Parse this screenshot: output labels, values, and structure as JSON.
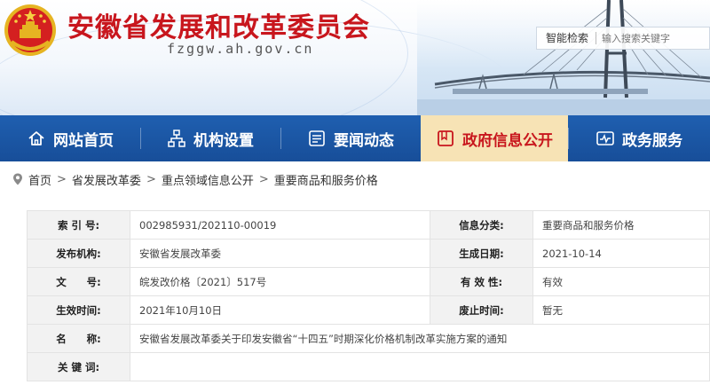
{
  "header": {
    "title": "安徽省发展和改革委员会",
    "domain": "fzggw.ah.gov.cn",
    "search_label": "智能检索",
    "search_placeholder": "输入搜索关键字"
  },
  "nav": {
    "items": [
      {
        "label": "网站首页",
        "icon": "home-icon"
      },
      {
        "label": "机构设置",
        "icon": "org-chart-icon"
      },
      {
        "label": "要闻动态",
        "icon": "news-icon"
      },
      {
        "label": "政府信息公开",
        "icon": "folder-icon",
        "active": true
      },
      {
        "label": "政务服务",
        "icon": "service-icon"
      }
    ]
  },
  "breadcrumb": [
    "首页",
    "省发展改革委",
    "重点领域信息公开",
    "重要商品和服务价格"
  ],
  "info": {
    "index_label": "索 引 号:",
    "index_value": "002985931/202110-00019",
    "category_label": "信息分类:",
    "category_value": "重要商品和服务价格",
    "publisher_label": "发布机构:",
    "publisher_value": "安徽省发展改革委",
    "created_label": "生成日期:",
    "created_value": "2021-10-14",
    "docno_label": "文　　号:",
    "docno_value": "皖发改价格〔2021〕517号",
    "validity_label": "有 效 性:",
    "validity_value": "有效",
    "effective_label": "生效时间:",
    "effective_value": "2021年10月10日",
    "repeal_label": "废止时间:",
    "repeal_value": "暂无",
    "name_label": "名　　称:",
    "name_value": "安徽省发展改革委关于印发安徽省“十四五”时期深化价格机制改革实施方案的通知",
    "keywords_label": "关 键 词:",
    "keywords_value": ""
  },
  "colors": {
    "title_red": "#c8161d",
    "nav_blue": "#1f5fb0",
    "nav_active_bg": "#f7e3b5"
  }
}
